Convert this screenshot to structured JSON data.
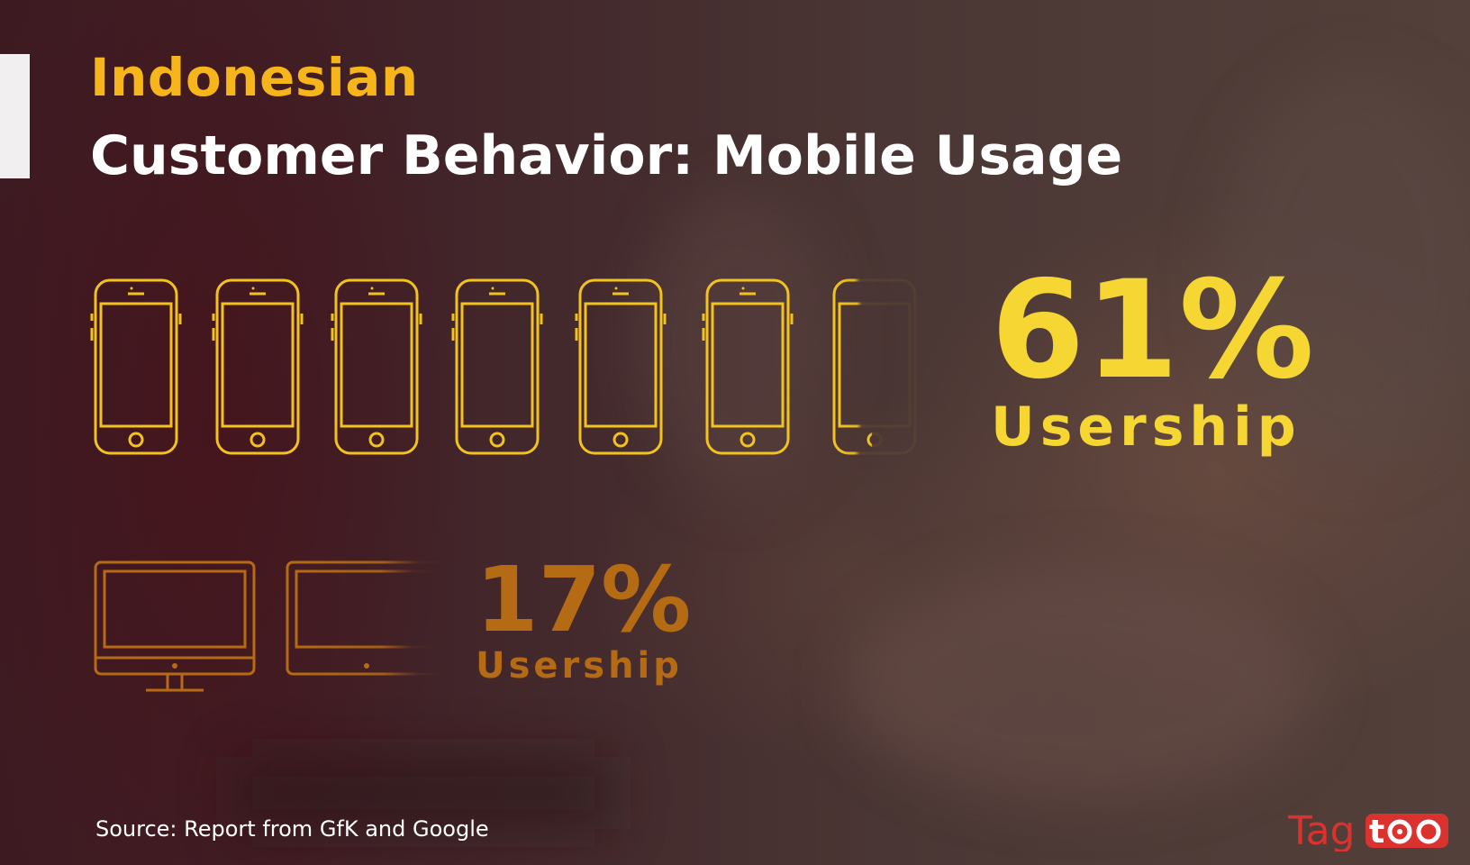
{
  "heading": {
    "line1": "Indonesian",
    "line2": "Customer Behavior: Mobile Usage"
  },
  "mobile": {
    "percent": "61%",
    "label": "Usership",
    "icon_count": 7,
    "color": "#f6d632"
  },
  "desktop": {
    "percent": "17%",
    "label": "Usership",
    "icon_count": 2,
    "color": "#b56b14"
  },
  "source": "Source: Report from GfK and Google",
  "logo": {
    "text_part1": "Tag",
    "text_part2": "too",
    "color": "#d9322f"
  },
  "colors": {
    "accent_yellow": "#f5b51b",
    "title_white": "#ffffff"
  }
}
